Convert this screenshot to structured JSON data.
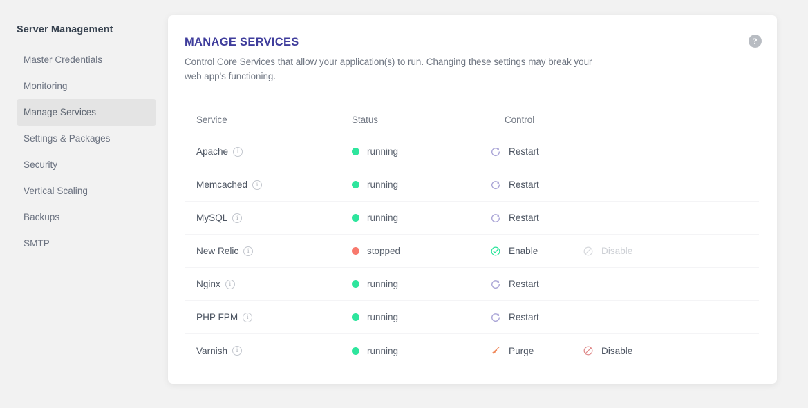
{
  "sidebar": {
    "title": "Server Management",
    "items": [
      {
        "label": "Master Credentials",
        "active": false
      },
      {
        "label": "Monitoring",
        "active": false
      },
      {
        "label": "Manage Services",
        "active": true
      },
      {
        "label": "Settings & Packages",
        "active": false
      },
      {
        "label": "Security",
        "active": false
      },
      {
        "label": "Vertical Scaling",
        "active": false
      },
      {
        "label": "Backups",
        "active": false
      },
      {
        "label": "SMTP",
        "active": false
      }
    ]
  },
  "card": {
    "title": "MANAGE SERVICES",
    "description": "Control Core Services that allow your application(s) to run. Changing these settings may break your web app's functioning.",
    "help_icon": "help-circle-icon",
    "help_label": "?"
  },
  "table": {
    "columns": [
      "Service",
      "Status",
      "Control"
    ],
    "rows": [
      {
        "service": "Apache",
        "info_icon": "info-icon",
        "status": "running",
        "status_state": "running",
        "actions": [
          {
            "label": "Restart",
            "icon": "refresh-icon",
            "disabled": false
          }
        ]
      },
      {
        "service": "Memcached",
        "info_icon": "info-icon",
        "status": "running",
        "status_state": "running",
        "actions": [
          {
            "label": "Restart",
            "icon": "refresh-icon",
            "disabled": false
          }
        ]
      },
      {
        "service": "MySQL",
        "info_icon": "info-icon",
        "status": "running",
        "status_state": "running",
        "actions": [
          {
            "label": "Restart",
            "icon": "refresh-icon",
            "disabled": false
          }
        ]
      },
      {
        "service": "New Relic",
        "info_icon": "info-icon",
        "status": "stopped",
        "status_state": "stopped",
        "actions": [
          {
            "label": "Enable",
            "icon": "check-circle-icon",
            "disabled": false
          },
          {
            "label": "Disable",
            "icon": "ban-circle-icon",
            "disabled": true
          }
        ]
      },
      {
        "service": "Nginx",
        "info_icon": "info-icon",
        "status": "running",
        "status_state": "running",
        "actions": [
          {
            "label": "Restart",
            "icon": "refresh-icon",
            "disabled": false
          }
        ]
      },
      {
        "service": "PHP FPM",
        "info_icon": "info-icon",
        "status": "running",
        "status_state": "running",
        "actions": [
          {
            "label": "Restart",
            "icon": "refresh-icon",
            "disabled": false
          }
        ]
      },
      {
        "service": "Varnish",
        "info_icon": "info-icon",
        "status": "running",
        "status_state": "running",
        "actions": [
          {
            "label": "Purge",
            "icon": "broom-icon",
            "disabled": false
          },
          {
            "label": "Disable",
            "icon": "ban-circle-icon",
            "disabled": false
          }
        ]
      }
    ]
  },
  "colors": {
    "title": "#3f3d9c",
    "running_dot": "#2ee59d",
    "stopped_dot": "#f8796d",
    "restart_icon": "#a9a4d6",
    "enable_icon": "#2ee59d",
    "purge_icon": "#f08a5d",
    "disable_icon": "#e08b8b",
    "disable_icon_muted": "#d8dade",
    "page_bg": "#f2f2f2",
    "card_bg": "#ffffff",
    "active_nav_bg": "#e4e4e4"
  }
}
